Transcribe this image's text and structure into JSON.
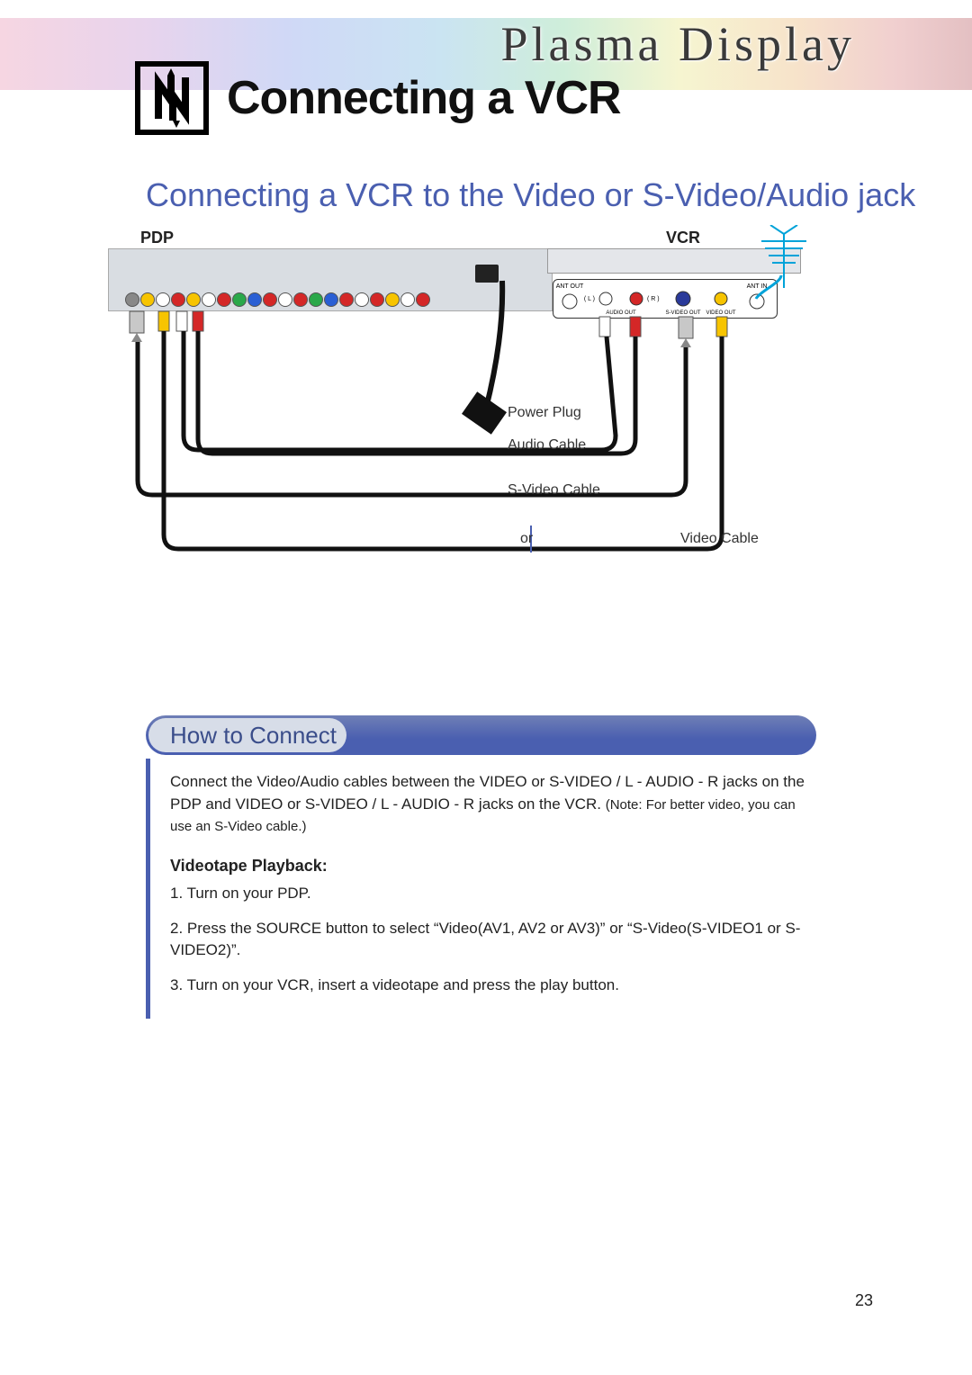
{
  "banner": {
    "brand": "Plasma Display"
  },
  "heading": {
    "title": "Connecting a VCR"
  },
  "subheading": "Connecting a VCR to the Video or S-Video/Audio jack",
  "diagram": {
    "pdp_label": "PDP",
    "vcr_label": "VCR",
    "vcr_ports": {
      "ant_out": "ANT OUT",
      "l": "( L )",
      "r": "( R )",
      "audio_out": "AUDIO OUT",
      "svideo_out": "S-VIDEO OUT",
      "video_out": "VIDEO OUT",
      "ant_in": "ANT IN"
    },
    "colors": {
      "svideo": "#00a3d9",
      "video_yellow": "#f7c400",
      "audio_white": "#ffffff",
      "audio_red": "#d42727",
      "generic_black": "#111111"
    },
    "labels": {
      "power_plug": "Power Plug",
      "audio_cable": "Audio Cable",
      "svideo_cable": "S-Video Cable",
      "video_cable": "Video Cable",
      "or": "or"
    }
  },
  "howto": {
    "title": "How to Connect",
    "intro_main": "Connect the Video/Audio cables between the VIDEO or S-VIDEO / L - AUDIO - R jacks on the PDP and VIDEO or S-VIDEO / L - AUDIO - R jacks on the VCR. ",
    "intro_note": "(Note: For better video, you can use an S-Video cable.)",
    "playback_heading": "Videotape Playback:",
    "steps": [
      "1.  Turn on your PDP.",
      "2.  Press the SOURCE button to select “Video(AV1, AV2 or AV3)” or “S-Video(S-VIDEO1 or S-VIDEO2)”.",
      "3.  Turn on your VCR, insert a videotape and press the play button."
    ]
  },
  "page_number": "23"
}
